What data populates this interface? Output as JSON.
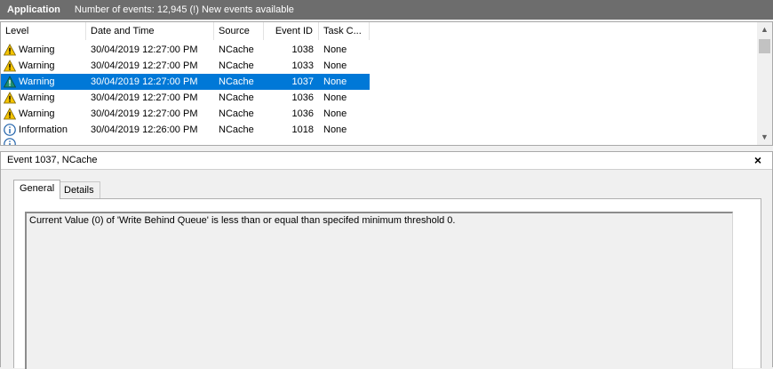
{
  "titlebar": {
    "log_name": "Application",
    "info": "Number of events: 12,945 (!) New events available"
  },
  "columns": [
    "Level",
    "Date and Time",
    "Source",
    "Event ID",
    "Task C..."
  ],
  "rows": [
    {
      "level": "Warning",
      "datetime": "30/04/2019 12:27:00 PM",
      "source": "NCache",
      "event_id": "1038",
      "task": "None",
      "icon": "warning-icon"
    },
    {
      "level": "Warning",
      "datetime": "30/04/2019 12:27:00 PM",
      "source": "NCache",
      "event_id": "1033",
      "task": "None",
      "icon": "warning-icon"
    },
    {
      "level": "Warning",
      "datetime": "30/04/2019 12:27:00 PM",
      "source": "NCache",
      "event_id": "1037",
      "task": "None",
      "icon": "warning-icon",
      "selected": true
    },
    {
      "level": "Warning",
      "datetime": "30/04/2019 12:27:00 PM",
      "source": "NCache",
      "event_id": "1036",
      "task": "None",
      "icon": "warning-icon"
    },
    {
      "level": "Warning",
      "datetime": "30/04/2019 12:27:00 PM",
      "source": "NCache",
      "event_id": "1036",
      "task": "None",
      "icon": "warning-icon"
    },
    {
      "level": "Information",
      "datetime": "30/04/2019 12:26:00 PM",
      "source": "NCache",
      "event_id": "1018",
      "task": "None",
      "icon": "info-icon"
    }
  ],
  "detail": {
    "title": "Event 1037, NCache",
    "close_label": "×",
    "tabs": {
      "general": "General",
      "details": "Details"
    },
    "message": "Current Value (0)  of 'Write Behind Queue' is less than or equal than specifed minimum threshold 0."
  },
  "colors": {
    "selection": "#0078d7",
    "titlebar": "#6d6d6d",
    "warning": "#f5c400",
    "info": "#1c5fa8"
  }
}
